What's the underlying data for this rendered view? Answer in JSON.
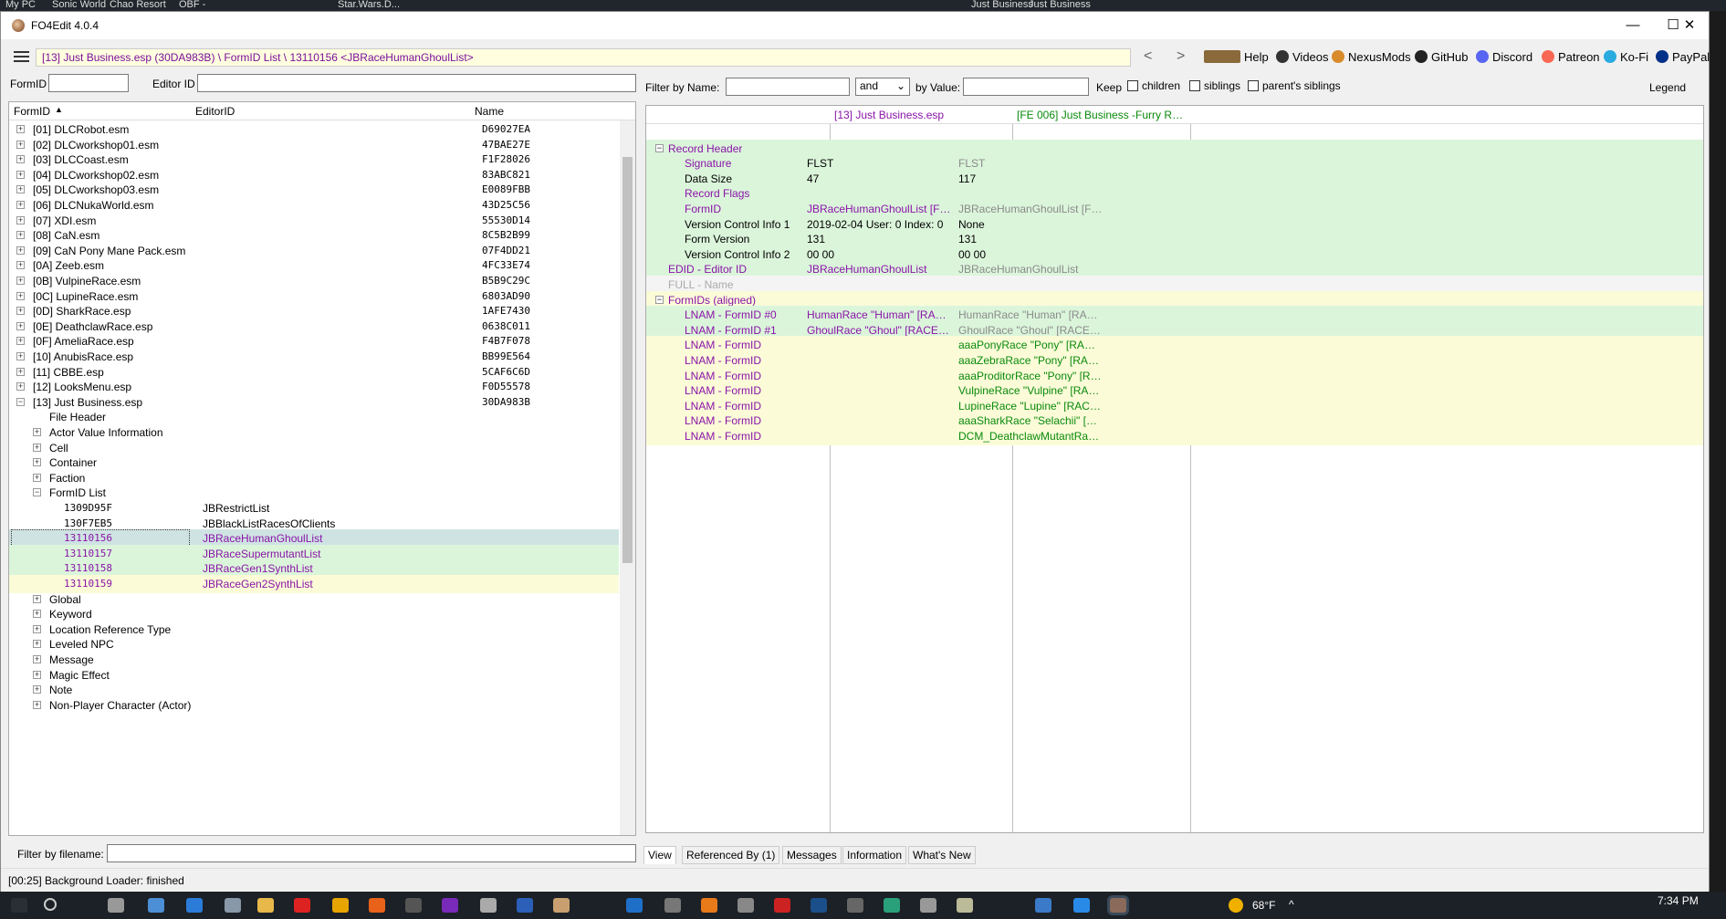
{
  "desktop_bar": [
    "My PC",
    "Sonic World",
    "Chao Resort",
    "OBF -",
    "Star.Wars.D...",
    "Just Business",
    "Just Business"
  ],
  "window": {
    "title": "FO4Edit 4.0.4",
    "min": "—",
    "max": "☐",
    "close": "✕"
  },
  "address": {
    "path": "[13] Just Business.esp (30DA983B) \\ FormID List \\ 13110156 <JBRaceHumanGhoulList>",
    "back": "<",
    "fwd": ">"
  },
  "toolbar": {
    "help": "Help",
    "videos": "Videos",
    "nexus": "NexusMods",
    "github": "GitHub",
    "discord": "Discord",
    "patreon": "Patreon",
    "kofi": "Ko-Fi",
    "paypal": "PayPal"
  },
  "left": {
    "formid_label": "FormID",
    "editorid_label": "Editor ID",
    "col_formid": "FormID",
    "col_editorid": "EditorID",
    "col_name": "Name",
    "filter_label": "Filter by filename:"
  },
  "tree": [
    {
      "lvl": 0,
      "exp": "+",
      "t": "[01] DLCRobot.esm",
      "n": "D69027EA"
    },
    {
      "lvl": 0,
      "exp": "+",
      "t": "[02] DLCworkshop01.esm",
      "n": "47BAE27E"
    },
    {
      "lvl": 0,
      "exp": "+",
      "t": "[03] DLCCoast.esm",
      "n": "F1F28026"
    },
    {
      "lvl": 0,
      "exp": "+",
      "t": "[04] DLCworkshop02.esm",
      "n": "83ABC821"
    },
    {
      "lvl": 0,
      "exp": "+",
      "t": "[05] DLCworkshop03.esm",
      "n": "E0089FBB"
    },
    {
      "lvl": 0,
      "exp": "+",
      "t": "[06] DLCNukaWorld.esm",
      "n": "43D25C56"
    },
    {
      "lvl": 0,
      "exp": "+",
      "t": "[07] XDI.esm",
      "n": "55530D14"
    },
    {
      "lvl": 0,
      "exp": "+",
      "t": "[08] CaN.esm",
      "n": "8C5B2B99"
    },
    {
      "lvl": 0,
      "exp": "+",
      "t": "[09] CaN Pony Mane Pack.esm",
      "n": "07F4DD21"
    },
    {
      "lvl": 0,
      "exp": "+",
      "t": "[0A] Zeeb.esm",
      "n": "4FC33E74"
    },
    {
      "lvl": 0,
      "exp": "+",
      "t": "[0B] VulpineRace.esm",
      "n": "B5B9C29C"
    },
    {
      "lvl": 0,
      "exp": "+",
      "t": "[0C] LupineRace.esm",
      "n": "6803AD90"
    },
    {
      "lvl": 0,
      "exp": "+",
      "t": "[0D] SharkRace.esp",
      "n": "1AFE7430"
    },
    {
      "lvl": 0,
      "exp": "+",
      "t": "[0E] DeathclawRace.esp",
      "n": "0638C011"
    },
    {
      "lvl": 0,
      "exp": "+",
      "t": "[0F] AmeliaRace.esp",
      "n": "F4B7F078"
    },
    {
      "lvl": 0,
      "exp": "+",
      "t": "[10] AnubisRace.esp",
      "n": "BB99E564"
    },
    {
      "lvl": 0,
      "exp": "+",
      "t": "[11] CBBE.esp",
      "n": "5CAF6C6D"
    },
    {
      "lvl": 0,
      "exp": "+",
      "t": "[12] LooksMenu.esp",
      "n": "F0D55578"
    },
    {
      "lvl": 0,
      "exp": "−",
      "t": "[13] Just Business.esp",
      "n": "30DA983B"
    },
    {
      "lvl": 1,
      "exp": "",
      "t": "File Header"
    },
    {
      "lvl": 1,
      "exp": "+",
      "t": "Actor Value Information"
    },
    {
      "lvl": 1,
      "exp": "+",
      "t": "Cell"
    },
    {
      "lvl": 1,
      "exp": "+",
      "t": "Container"
    },
    {
      "lvl": 1,
      "exp": "+",
      "t": "Faction"
    },
    {
      "lvl": 1,
      "exp": "−",
      "t": "FormID List"
    },
    {
      "lvl": 2,
      "exp": "",
      "t": "1309D95F",
      "e": "JBRestrictList",
      "bg": "#fff",
      "c": "#000"
    },
    {
      "lvl": 2,
      "exp": "",
      "t": "130F7EB5",
      "e": "JBBlackListRacesOfClients",
      "bg": "#fff",
      "c": "#000"
    },
    {
      "lvl": 2,
      "exp": "",
      "t": "13110156",
      "e": "JBRaceHumanGhoulList",
      "bg": "#cfe3e3",
      "c": "#8a14a8",
      "sel": true
    },
    {
      "lvl": 2,
      "exp": "",
      "t": "13110157",
      "e": "JBRaceSupermutantList",
      "bg": "#dbf5db",
      "c": "#8a14a8"
    },
    {
      "lvl": 2,
      "exp": "",
      "t": "13110158",
      "e": "JBRaceGen1SynthList",
      "bg": "#dbf5db",
      "c": "#8a14a8"
    },
    {
      "lvl": 2,
      "exp": "",
      "t": "13110159",
      "e": "JBRaceGen2SynthList",
      "bg": "#fbfbd8",
      "c": "#8a14a8"
    },
    {
      "lvl": 1,
      "exp": "+",
      "t": "Global"
    },
    {
      "lvl": 1,
      "exp": "+",
      "t": "Keyword"
    },
    {
      "lvl": 1,
      "exp": "+",
      "t": "Location Reference Type"
    },
    {
      "lvl": 1,
      "exp": "+",
      "t": "Leveled NPC"
    },
    {
      "lvl": 1,
      "exp": "+",
      "t": "Message"
    },
    {
      "lvl": 1,
      "exp": "+",
      "t": "Magic Effect"
    },
    {
      "lvl": 1,
      "exp": "+",
      "t": "Note"
    },
    {
      "lvl": 1,
      "exp": "+",
      "t": "Non-Player Character (Actor)"
    }
  ],
  "filter": {
    "by_name": "Filter by Name:",
    "and": "and",
    "by_value": "by Value:",
    "keep": "Keep",
    "children": "children",
    "siblings": "siblings",
    "parents": "parent's siblings",
    "legend": "Legend"
  },
  "record": {
    "col1": "[13] Just Business.esp",
    "col2": "[FE 006] Just Business -Furry Race...",
    "rows": [
      {
        "ind": 0,
        "exp": "−",
        "k": "Record Header",
        "a": "",
        "b": "",
        "bg": "#dbf5db",
        "kc": "#8a14a8",
        "ac": "#000",
        "bc": "#000"
      },
      {
        "ind": 1,
        "k": "Signature",
        "a": "FLST",
        "b": "FLST",
        "bg": "#dbf5db",
        "kc": "#8a14a8",
        "ac": "#000",
        "bc": "#8a8a8a"
      },
      {
        "ind": 1,
        "k": "Data Size",
        "a": "47",
        "b": "117",
        "bg": "#dbf5db",
        "kc": "#000",
        "ac": "#000",
        "bc": "#000"
      },
      {
        "ind": 1,
        "k": "Record Flags",
        "a": "",
        "b": "",
        "bg": "#dbf5db",
        "kc": "#8a14a8",
        "ac": "#000",
        "bc": "#000"
      },
      {
        "ind": 1,
        "k": "FormID",
        "a": "JBRaceHumanGhoulList [FLST:13...",
        "b": "JBRaceHumanGhoulList [FLST:13...",
        "bg": "#dbf5db",
        "kc": "#8a14a8",
        "ac": "#8a14a8",
        "bc": "#8a8a8a"
      },
      {
        "ind": 1,
        "k": "Version Control Info 1",
        "a": "2019-02-04 User: 0 Index: 0",
        "b": "None",
        "bg": "#dbf5db",
        "kc": "#000",
        "ac": "#000",
        "bc": "#000"
      },
      {
        "ind": 1,
        "k": "Form Version",
        "a": "131",
        "b": "131",
        "bg": "#dbf5db",
        "kc": "#000",
        "ac": "#000",
        "bc": "#000"
      },
      {
        "ind": 1,
        "k": "Version Control Info 2",
        "a": "00 00",
        "b": "00 00",
        "bg": "#dbf5db",
        "kc": "#000",
        "ac": "#000",
        "bc": "#000"
      },
      {
        "ind": 0,
        "k": "EDID - Editor ID",
        "a": "JBRaceHumanGhoulList",
        "b": "JBRaceHumanGhoulList",
        "bg": "#dbf5db",
        "kc": "#8a14a8",
        "ac": "#8a14a8",
        "bc": "#8a8a8a"
      },
      {
        "ind": 0,
        "k": "FULL - Name",
        "a": "",
        "b": "",
        "bg": "#f4f4f4",
        "kc": "#aaaaaa",
        "ac": "#000",
        "bc": "#000"
      },
      {
        "ind": 0,
        "exp": "−",
        "k": "FormIDs (aligned)",
        "a": "",
        "b": "",
        "bg": "#fbfbd8",
        "kc": "#8a14a8",
        "ac": "#000",
        "bc": "#000"
      },
      {
        "ind": 1,
        "k": "LNAM - FormID #0",
        "a": "HumanRace \"Human\" [RACE:00...",
        "b": "HumanRace \"Human\" [RACE:00...",
        "bg": "#dbf5db",
        "kc": "#8a14a8",
        "ac": "#8a14a8",
        "bc": "#8a8a8a"
      },
      {
        "ind": 1,
        "k": "LNAM - FormID #1",
        "a": "GhoulRace \"Ghoul\" [RACE:000EA...",
        "b": "GhoulRace \"Ghoul\" [RACE:000EA...",
        "bg": "#dbf5db",
        "kc": "#8a14a8",
        "ac": "#8a14a8",
        "bc": "#8a8a8a"
      },
      {
        "ind": 1,
        "k": "LNAM - FormID",
        "a": "",
        "b": "aaaPonyRace \"Pony\" [RACE:0800...",
        "bg": "#fbfbd8",
        "kc": "#8a14a8",
        "ac": "#000",
        "bc": "#0a8a0a"
      },
      {
        "ind": 1,
        "k": "LNAM - FormID",
        "a": "",
        "b": "aaaZebraRace \"Pony\" [RACE:0A0...",
        "bg": "#fbfbd8",
        "kc": "#8a14a8",
        "ac": "#000",
        "bc": "#0a8a0a"
      },
      {
        "ind": 1,
        "k": "LNAM - FormID",
        "a": "",
        "b": "aaaProditorRace \"Pony\" [RACE:0...",
        "bg": "#fbfbd8",
        "kc": "#8a14a8",
        "ac": "#000",
        "bc": "#0a8a0a"
      },
      {
        "ind": 1,
        "k": "LNAM - FormID",
        "a": "",
        "b": "VulpineRace \"Vulpine\" [RACE:0B...",
        "bg": "#fbfbd8",
        "kc": "#8a14a8",
        "ac": "#000",
        "bc": "#0a8a0a"
      },
      {
        "ind": 1,
        "k": "LNAM - FormID",
        "a": "",
        "b": "LupineRace \"Lupine\" [RACE:0C0...",
        "bg": "#fbfbd8",
        "kc": "#8a14a8",
        "ac": "#000",
        "bc": "#0a8a0a"
      },
      {
        "ind": 1,
        "k": "LNAM - FormID",
        "a": "",
        "b": "aaaSharkRace \"Selachii\" [RACE:0...",
        "bg": "#fbfbd8",
        "kc": "#8a14a8",
        "ac": "#000",
        "bc": "#0a8a0a"
      },
      {
        "ind": 1,
        "k": "LNAM - FormID",
        "a": "",
        "b": "DCM_DeathclawMutantRace \"De...",
        "bg": "#fbfbd8",
        "kc": "#8a14a8",
        "ac": "#000",
        "bc": "#0a8a0a"
      }
    ]
  },
  "tabs": [
    "View",
    "Referenced By (1)",
    "Messages",
    "Information",
    "What's New"
  ],
  "status": "[00:25] Background Loader: finished",
  "taskbar": {
    "temp": "68°F",
    "time": "7:34 PM"
  }
}
